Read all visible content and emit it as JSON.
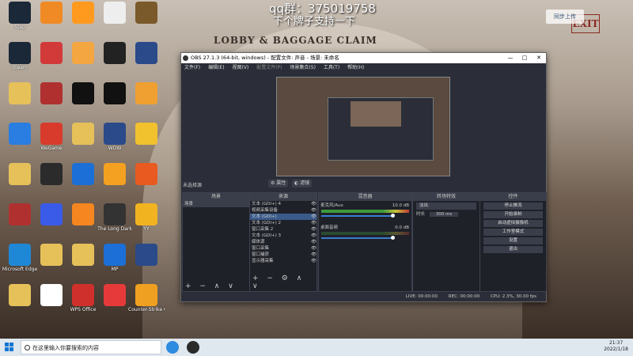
{
  "overlay": {
    "qq_line": "qq群：375019758",
    "sub_line": "下个牌子支持一下",
    "top_right_btn": "同步上传"
  },
  "background": {
    "sign": "LOBBY & BAGGAGE CLAIM",
    "exit_sign": "EXIT"
  },
  "desktop_icons": [
    {
      "label": "Step",
      "color": "#1b2838"
    },
    {
      "label": "Steam",
      "color": "#1b2838"
    },
    {
      "label": "",
      "color": "#e6c15a"
    },
    {
      "label": "",
      "color": "#2a7de1"
    },
    {
      "label": "",
      "color": "#e6c15a"
    },
    {
      "label": "",
      "color": "#b03030"
    },
    {
      "label": "Microsoft Edge",
      "color": "#1e88d6"
    },
    {
      "label": "",
      "color": "#e6c15a"
    },
    {
      "label": "",
      "color": "#f08a24"
    },
    {
      "label": "",
      "color": "#d23a3a"
    },
    {
      "label": "",
      "color": "#b03030"
    },
    {
      "label": "WeGame",
      "color": "#d83b2b"
    },
    {
      "label": "",
      "color": "#2b2b2b"
    },
    {
      "label": "",
      "color": "#3a5ae8"
    },
    {
      "label": "",
      "color": "#e6c15a"
    },
    {
      "label": "",
      "color": "#ffffff"
    },
    {
      "label": "",
      "color": "#ff9a1f"
    },
    {
      "label": "",
      "color": "#f4a640"
    },
    {
      "label": "",
      "color": "#111111"
    },
    {
      "label": "",
      "color": "#e6c15a"
    },
    {
      "label": "",
      "color": "#1c6fd6"
    },
    {
      "label": "",
      "color": "#f6861f"
    },
    {
      "label": "",
      "color": "#e6c15a"
    },
    {
      "label": "WPS Office",
      "color": "#d0302b"
    },
    {
      "label": "",
      "color": "#eeeeee"
    },
    {
      "label": "",
      "color": "#222222"
    },
    {
      "label": "",
      "color": "#111111"
    },
    {
      "label": "WOW",
      "color": "#2a4a8a"
    },
    {
      "label": "",
      "color": "#f4a020"
    },
    {
      "label": "The Long Dark",
      "color": "#333333"
    },
    {
      "label": "MP",
      "color": "#1c6fd6"
    },
    {
      "label": "",
      "color": "#e63a3a"
    },
    {
      "label": "",
      "color": "#7a5a2a"
    },
    {
      "label": "",
      "color": "#2a4a8a"
    },
    {
      "label": "",
      "color": "#f0a030"
    },
    {
      "label": "",
      "color": "#f2c12e"
    },
    {
      "label": "",
      "color": "#e85a20"
    },
    {
      "label": "YY",
      "color": "#f2b320"
    },
    {
      "label": "",
      "color": "#2a4a8a"
    },
    {
      "label": "Counter-Strike Global Off...",
      "color": "#f0a020"
    }
  ],
  "obs": {
    "title": "OBS 27.1.3 (64-bit, windows) - 配置文件: 声音 - 场景: 未命名",
    "menu": [
      "文件(F)",
      "编辑(E)",
      "视图(V)",
      "配置文件(P)",
      "场景集合(S)",
      "工具(T)",
      "帮助(H)"
    ],
    "no_source": "未选择源",
    "props_btn": "属性",
    "filters_btn": "滤镜",
    "docks": {
      "scenes": {
        "title": "场景",
        "items": [
          "场景"
        ]
      },
      "sources": {
        "title": "来源",
        "items": [
          "文本 (GDI+) 4",
          "视频采集设备",
          "文本 (GDI+)",
          "文本 (GDI+) 2",
          "窗口采集 2",
          "文本 (GDI+) 3",
          "媒体源",
          "窗口采集",
          "窗口捕获",
          "显示器采集"
        ]
      },
      "mixer": {
        "title": "混音器",
        "tracks": [
          {
            "name": "麦克风/Aux",
            "db": "10.0 dB"
          },
          {
            "name": "桌面音频",
            "db": "0.0 dB"
          }
        ]
      },
      "transitions": {
        "title": "转场特效",
        "type": "淡出",
        "duration_label": "时长",
        "duration": "300 ms"
      },
      "controls": {
        "title": "控件",
        "buttons": [
          "停止推流",
          "开始录制",
          "启动虚拟摄像机",
          "工作室模式",
          "设置",
          "退出"
        ]
      }
    },
    "status": {
      "live": "LIVE: 00:00:00",
      "rec": "REC: 00:00:00",
      "cpu": "CPU: 2.3%, 30.00 fps"
    }
  },
  "taskbar": {
    "search_placeholder": "在这里输入你要搜索的内容",
    "time": "21:37",
    "date": "2022/1/18"
  }
}
